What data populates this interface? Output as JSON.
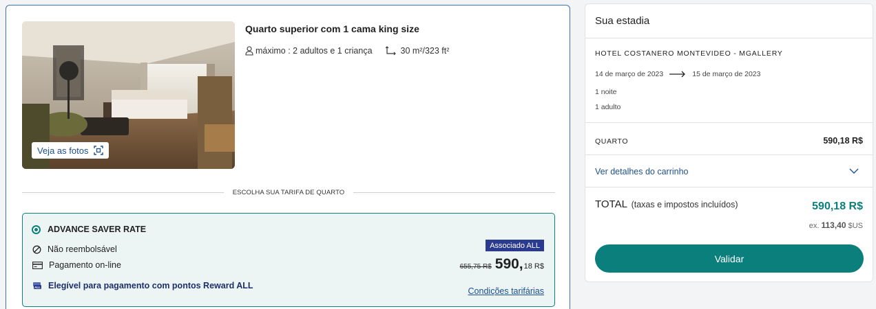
{
  "room": {
    "photos_button": "Veja as fotos",
    "title": "Quarto superior com 1 cama king size",
    "capacity": "máximo : 2 adultos e 1 criança",
    "area": "30 m²/323 ft²"
  },
  "rate_section": {
    "divider_label": "ESCOLHA SUA TARIFA DE QUARTO",
    "rate_name": "ADVANCE SAVER RATE",
    "refund": "Não reembolsável",
    "payment": "Pagamento on-line",
    "reward": "Elegível para pagamento com pontos Reward ALL",
    "member_badge": "Associado ALL",
    "old_price": "655,75 R$",
    "price_int": "590,",
    "price_dec": "18 R$",
    "conditions_link": "Condições tarifárias"
  },
  "stay": {
    "title": "Sua estadia",
    "hotel_name": "HOTEL COSTANERO MONTEVIDEO - MGALLERY",
    "check_in": "14 de março de 2023",
    "check_out": "15 de março de 2023",
    "nights": "1 noite",
    "guests": "1 adulto",
    "room_label": "QUARTO",
    "room_price": "590,18 R$",
    "cart_details": "Ver detalhes do carrinho",
    "total_label": "TOTAL",
    "total_note": "(taxas e impostos incluídos)",
    "total_price": "590,18 R$",
    "usd_prefix": "ex.",
    "usd_value": "113,40",
    "usd_currency": "$US",
    "validate_button": "Validar"
  },
  "colors": {
    "accent_teal": "#0a7f7b",
    "link_blue": "#1c4f8e",
    "badge_navy": "#2a3b8f"
  }
}
